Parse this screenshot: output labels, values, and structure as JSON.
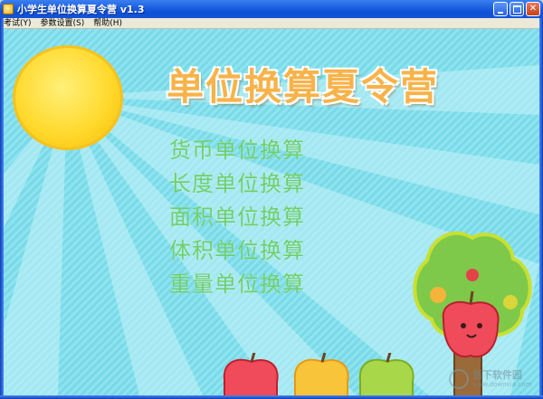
{
  "window": {
    "title": "小学生单位换算夏令营 v1.3"
  },
  "menubar": {
    "items": [
      {
        "label": "考试(Y)"
      },
      {
        "label": "参数设置(S)"
      },
      {
        "label": "帮助(H)"
      }
    ]
  },
  "main": {
    "banner": "单位换算夏令营",
    "options": [
      {
        "label": "货币单位换算"
      },
      {
        "label": "长度单位换算"
      },
      {
        "label": "面积单位换算"
      },
      {
        "label": "体积单位换算"
      },
      {
        "label": "重量单位换算"
      }
    ]
  },
  "watermark": {
    "text": "当下软件园",
    "sub": "www.downxia.com"
  },
  "colors": {
    "background": "#8ee4ef",
    "banner": "#f7b34a",
    "option_text": "#6fcf6a",
    "sun": "#ffd92c",
    "titlebar": "#1b5fe0"
  }
}
